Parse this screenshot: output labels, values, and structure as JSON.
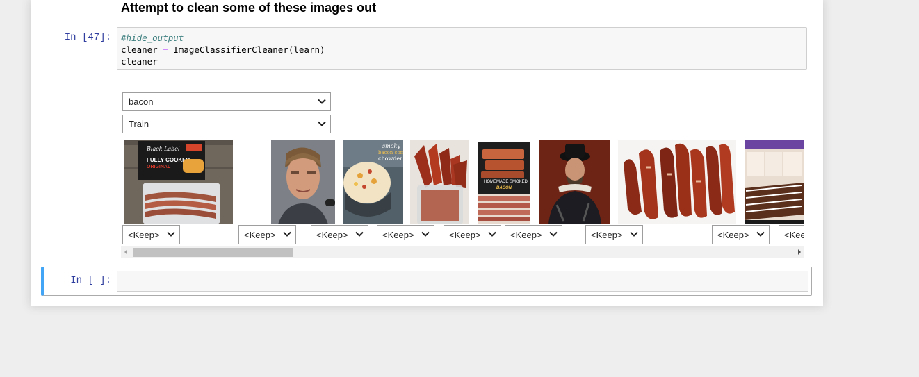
{
  "markdown": {
    "heading": "Attempt to clean some of these images out"
  },
  "code_cell": {
    "prompt": "In [47]:",
    "lines": {
      "comment": "#hide_output",
      "line2_var": "cleaner",
      "line2_op": "=",
      "line2_call": "ImageClassifierCleaner(learn)",
      "line3": "cleaner"
    }
  },
  "widget": {
    "category_select": {
      "value": "bacon"
    },
    "split_select": {
      "value": "Train"
    },
    "image_action_label": "<Keep>",
    "thumbnails": [
      {
        "subject": "packaged fully cooked bacon",
        "text_line1": "Black Label",
        "text_line2": "FULLY COOKED",
        "text_line3": "ORIGINAL"
      },
      {
        "subject": "man portrait"
      },
      {
        "subject": "bacon corn chowder bowl",
        "text_line1": "smoky",
        "text_line2": "bacon corn",
        "text_line3": "chowder"
      },
      {
        "subject": "candied bacon in jar"
      },
      {
        "subject": "homemade smoked bacon",
        "text_line1": "HOMEMADE SMOKED",
        "text_line2": "BACON"
      },
      {
        "subject": "painting of man in hat"
      },
      {
        "subject": "bacon strips on white"
      },
      {
        "subject": "chocolate dipped bacon"
      },
      {
        "subject": "candied bacon partial"
      }
    ]
  },
  "empty_cell": {
    "prompt": "In [ ]:"
  },
  "colors": {
    "prompt": "#303f9f",
    "selected_cell_border": "#42a5f5",
    "page_bg": "#eeeeee"
  },
  "icons": {
    "select": "chevron-down-icon",
    "scroll_left": "scroll-left-arrow-icon",
    "scroll_right": "scroll-right-arrow-icon"
  }
}
